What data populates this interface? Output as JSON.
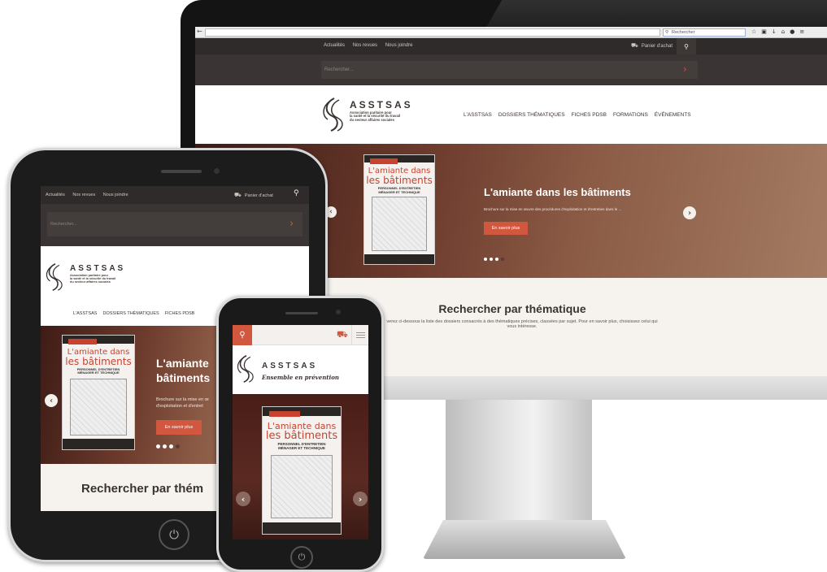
{
  "browser": {
    "search_placeholder": "Rechercher"
  },
  "site": {
    "nav_links": [
      "Actualités",
      "Nos revues",
      "Nous joindre"
    ],
    "cart_label": "Panier d'achat",
    "search_placeholder": "Rechercher...",
    "brand": "ASSTSAS",
    "tagline_lines": [
      "Association paritaire pour",
      "la santé et la sécurité du travail",
      "du secteur affaires sociales"
    ],
    "mobile_tagline": "Ensemble en prévention",
    "main_menu": [
      "L'ASSTSAS",
      "DOSSIERS THÉMATIQUES",
      "FICHES PDSB",
      "FORMATIONS",
      "ÉVÉNEMENTS"
    ],
    "hero": {
      "title": "L'amiante dans les bâtiments",
      "tablet_title_lines": [
        "L'amiante",
        "bâtiments"
      ],
      "description": "Brochure sur la mise en œuvre des procédures d'exploitation et d'entretien dans le ...",
      "tablet_desc_lines": [
        "Brochure sur la mise en œ",
        "d'exploitation et d'entret"
      ],
      "button": "En savoir plus",
      "book": {
        "series": "SPÉCIAL PRÉVENTION",
        "title_line1": "L'amiante dans",
        "title_line2": "les bâtiments",
        "subtitle_line1": "PERSONNEL D'ENTRETIEN",
        "subtitle_line2": "MÉNAGER ET TECHNIQUE"
      }
    },
    "section": {
      "title": "Rechercher par thématique",
      "tablet_title": "Rechercher par thém",
      "description": "verez ci-dessous la liste des dossiers consacrés à des thématiques précises, classées par sujet. Pour en savoir plus, choisissez celui qui vous intéresse."
    }
  },
  "icons": {
    "prev": "‹",
    "next": "›",
    "search": "⚲",
    "cart": "🛒",
    "home": "⏻"
  },
  "colors": {
    "accent": "#d1573e",
    "dark_nav": "#2f2b2a",
    "hero_dark": "#3e1c16"
  }
}
